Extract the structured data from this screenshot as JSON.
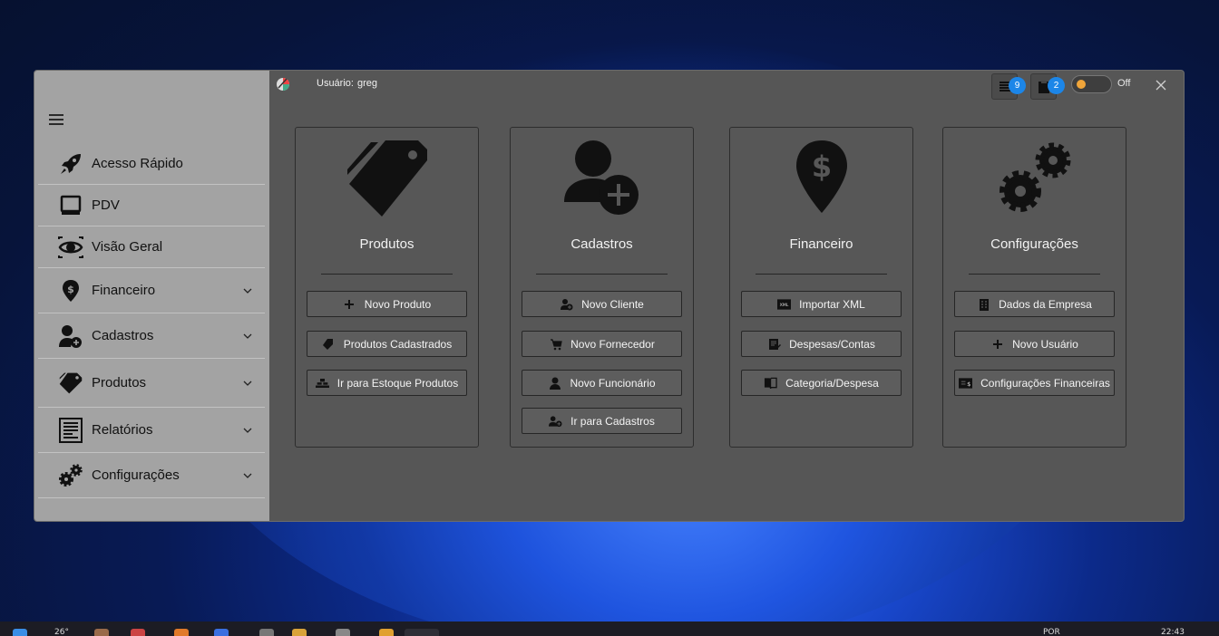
{
  "colors": {
    "accent": "#1c86e8",
    "sidebar_bg": "#a3a3a3",
    "main_bg": "#565656",
    "toggle_knob": "#f0a53a"
  },
  "header": {
    "user_label": "Usuário:",
    "user_name": "greg",
    "badge_1": "9",
    "badge_2": "2",
    "toggle_label": "Off"
  },
  "sidebar": {
    "items": [
      {
        "label": "Acesso Rápido",
        "icon": "rocket-icon"
      },
      {
        "label": "PDV",
        "icon": "monitor-icon"
      },
      {
        "label": "Visão Geral",
        "icon": "eye-icon"
      },
      {
        "label": "Financeiro",
        "icon": "money-pin-icon"
      },
      {
        "label": "Cadastros",
        "icon": "add-user-icon"
      },
      {
        "label": "Produtos",
        "icon": "tags-icon"
      },
      {
        "label": "Relatórios",
        "icon": "report-icon"
      },
      {
        "label": "Configurações",
        "icon": "gears-icon"
      }
    ]
  },
  "cards": [
    {
      "title": "Produtos",
      "icon": "tags-icon",
      "buttons": [
        {
          "label": "Novo Produto",
          "icon": "plus-icon"
        },
        {
          "label": "Produtos Cadastrados",
          "icon": "tag-icon"
        },
        {
          "label": "Ir para Estoque Produtos",
          "icon": "stock-icon"
        }
      ]
    },
    {
      "title": "Cadastros",
      "icon": "add-user-icon",
      "buttons": [
        {
          "label": "Novo Cliente",
          "icon": "user-add-icon"
        },
        {
          "label": "Novo Fornecedor",
          "icon": "cart-icon"
        },
        {
          "label": "Novo Funcionário",
          "icon": "person-icon"
        },
        {
          "label": "Ir para Cadastros",
          "icon": "users-icon"
        }
      ]
    },
    {
      "title": "Financeiro",
      "icon": "money-pin-icon",
      "buttons": [
        {
          "label": "Importar XML",
          "icon": "xml-icon"
        },
        {
          "label": "Despesas/Contas",
          "icon": "edit-doc-icon"
        },
        {
          "label": "Categoria/Despesa",
          "icon": "book-icon"
        }
      ]
    },
    {
      "title": "Configurações",
      "icon": "gears-icon",
      "buttons": [
        {
          "label": "Dados da Empresa",
          "icon": "building-icon"
        },
        {
          "label": "Novo Usuário",
          "icon": "plus-icon"
        },
        {
          "label": "Configurações Financeiras",
          "icon": "finance-settings-icon"
        }
      ]
    }
  ],
  "taskbar": {
    "temperature": "26°",
    "lang": "POR",
    "time": "22:43"
  }
}
